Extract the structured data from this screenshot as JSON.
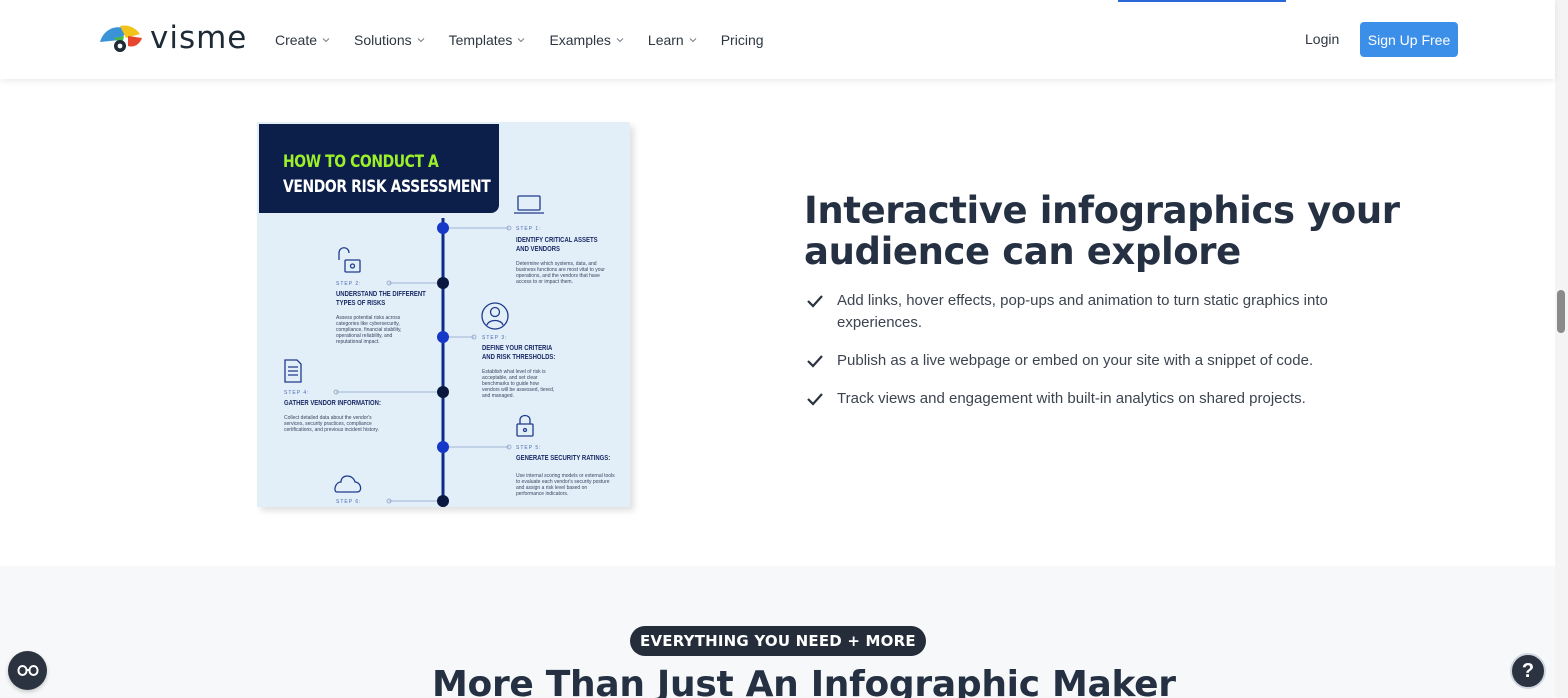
{
  "header": {
    "logo_text": "visme",
    "nav": [
      {
        "label": "Create",
        "has_dropdown": true
      },
      {
        "label": "Solutions",
        "has_dropdown": true
      },
      {
        "label": "Templates",
        "has_dropdown": true
      },
      {
        "label": "Examples",
        "has_dropdown": true
      },
      {
        "label": "Learn",
        "has_dropdown": true
      },
      {
        "label": "Pricing",
        "has_dropdown": false
      }
    ],
    "login_label": "Login",
    "signup_label": "Sign Up Free"
  },
  "infographic": {
    "title_line1": "HOW TO CONDUCT A",
    "title_line2": "VENDOR RISK ASSESSMENT",
    "steps": [
      {
        "label": "STEP 1:",
        "heading_lines": [
          "IDENTIFY CRITICAL ASSETS",
          "AND VENDORS"
        ],
        "body": "Determine which systems, data, and business functions are most vital to your operations, and the vendors that have access to or impact them.",
        "icon": "laptop-icon"
      },
      {
        "label": "STEP 2:",
        "heading_lines": [
          "UNDERSTAND THE DIFFERENT",
          "TYPES OF RISKS"
        ],
        "body": "Assess potential risks across categories like cybersecurity, compliance, financial stability, operational reliability, and reputational impact.",
        "icon": "unlock-icon"
      },
      {
        "label": "STEP 3:",
        "heading_lines": [
          "DEFINE YOUR CRITERIA",
          "AND RISK THRESHOLDS:"
        ],
        "body": "Establish what level of risk is acceptable, and set clear benchmarks to guide how vendors will be assessed, tiered, and managed.",
        "icon": "user-icon"
      },
      {
        "label": "STEP 4:",
        "heading_lines": [
          "GATHER VENDOR INFORMATION:"
        ],
        "body": "Collect detailed data about the vendor's services, security practices, compliance certifications, and previous incident history.",
        "icon": "document-icon"
      },
      {
        "label": "STEP 5:",
        "heading_lines": [
          "GENERATE SECURITY RATINGS:"
        ],
        "body": "Use internal scoring models or external tools to evaluate each vendor's security posture and assign a risk level based on performance indicators.",
        "icon": "lock-icon"
      },
      {
        "label": "STEP 6:",
        "heading_lines": [],
        "body": "",
        "icon": "cloud-icon"
      }
    ]
  },
  "feature": {
    "headline_line1": "Interactive infographics your",
    "headline_line2": "audience can explore",
    "bullets": [
      "Add links, hover effects, pop-ups and animation to turn static graphics into experiences.",
      "Publish as a live webpage or embed on your site with a snippet of code.",
      "Track views and engagement with built-in analytics on shared projects."
    ]
  },
  "lower": {
    "badge": "EVERYTHING YOU NEED + MORE",
    "title": "More Than Just An Infographic Maker"
  },
  "help_label": "?",
  "colors": {
    "accent": "#3b8fe8",
    "dark": "#253142",
    "infographic_bg": "#e2eef8",
    "infographic_title_bg": "#0c1f4a",
    "infographic_green": "#9cf02a"
  }
}
